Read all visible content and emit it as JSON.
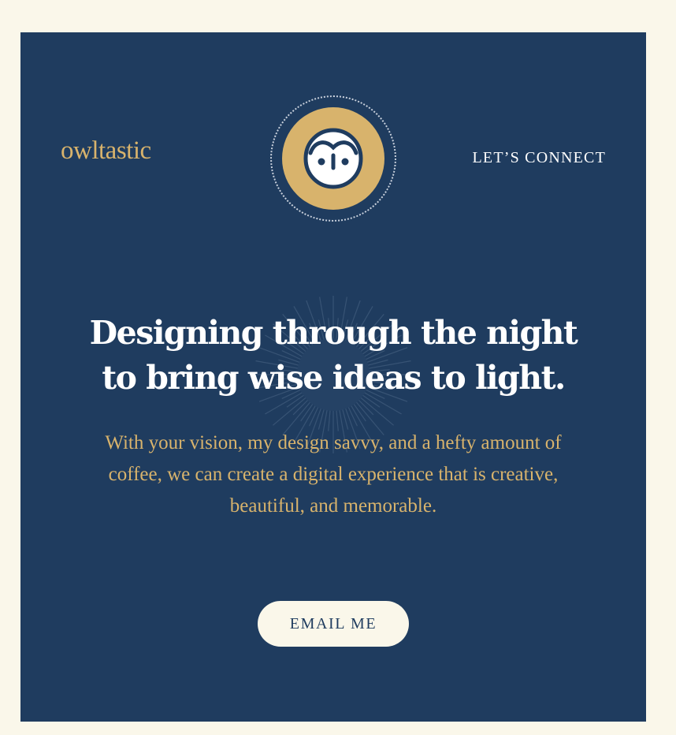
{
  "brand": {
    "name": "owltastic"
  },
  "nav": {
    "connect_label": "LET’S CONNECT"
  },
  "logo": {
    "icon": "owl-face-icon"
  },
  "hero": {
    "headline": "Designing through the night to bring wise ideas to light.",
    "subcopy": "With your vision, my design savvy, and a hefty amount of coffee, we can create a digital experience that is creative, beautiful, and memorable.",
    "cta_label": "EMAIL ME"
  },
  "colors": {
    "page_background": "#faf7ea",
    "panel_background": "#1f3c5f",
    "accent_gold": "#d8b36c",
    "headline_text": "#ffffff",
    "button_background": "#faf7ea",
    "button_text": "#1f3c5f"
  }
}
